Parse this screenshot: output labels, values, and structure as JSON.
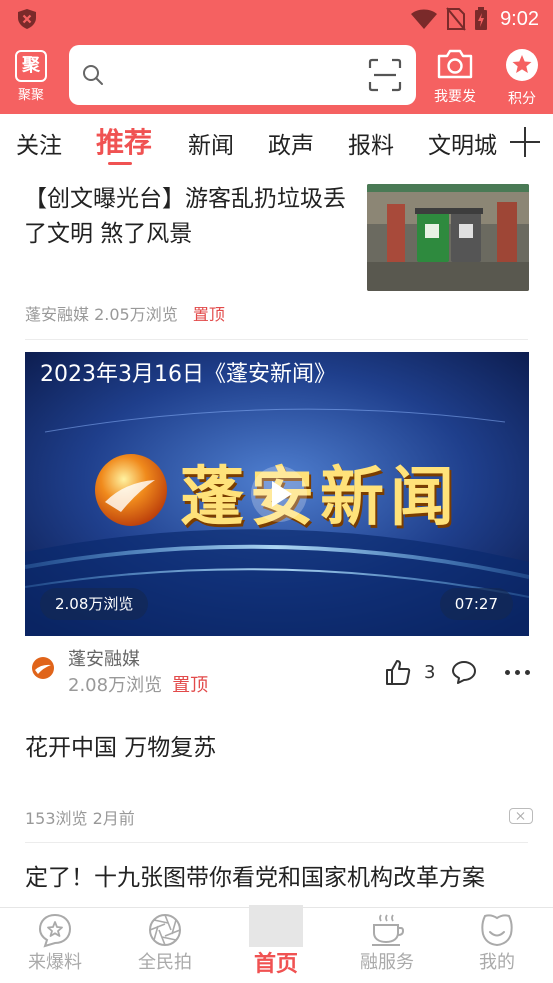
{
  "status_bar": {
    "time": "9:02"
  },
  "header": {
    "logo_label": "聚聚",
    "logo_glyph": "聚",
    "search_placeholder": "",
    "camera_label": "我要发",
    "points_label": "积分",
    "accent_color": "#f56161"
  },
  "tabs": {
    "items": [
      {
        "label": "关注",
        "active": false
      },
      {
        "label": "推荐",
        "active": true
      },
      {
        "label": "新闻",
        "active": false
      },
      {
        "label": "政声",
        "active": false
      },
      {
        "label": "报料",
        "active": false
      },
      {
        "label": "文明城",
        "active": false
      }
    ],
    "add_icon": "plus-icon"
  },
  "feed": {
    "article1": {
      "title": "【创文曝光台】游客乱扔垃圾丢了文明 煞了风景",
      "source": "蓬安融媒",
      "views": "2.05万浏览",
      "pin": "置顶"
    },
    "video": {
      "title": "2023年3月16日《蓬安新闻》",
      "brand_text": "蓬安新闻",
      "views_badge": "2.08万浏览",
      "duration": "07:27",
      "source": "蓬安融媒",
      "views": "2.08万浏览",
      "pin": "置顶",
      "likes": "3"
    },
    "article2": {
      "title": "花开中国 万物复苏",
      "meta": "153浏览 2月前"
    },
    "article3": {
      "title": "定了！十九张图带你看党和国家机构改革方案"
    }
  },
  "bottom_nav": {
    "items": [
      {
        "label": "来爆料",
        "icon": "star-chat-icon"
      },
      {
        "label": "全民拍",
        "icon": "aperture-icon"
      },
      {
        "label": "首页",
        "icon": "home-icon",
        "active": true
      },
      {
        "label": "融服务",
        "icon": "cup-icon"
      },
      {
        "label": "我的",
        "icon": "smile-icon"
      }
    ],
    "active_color": "#f05252"
  }
}
